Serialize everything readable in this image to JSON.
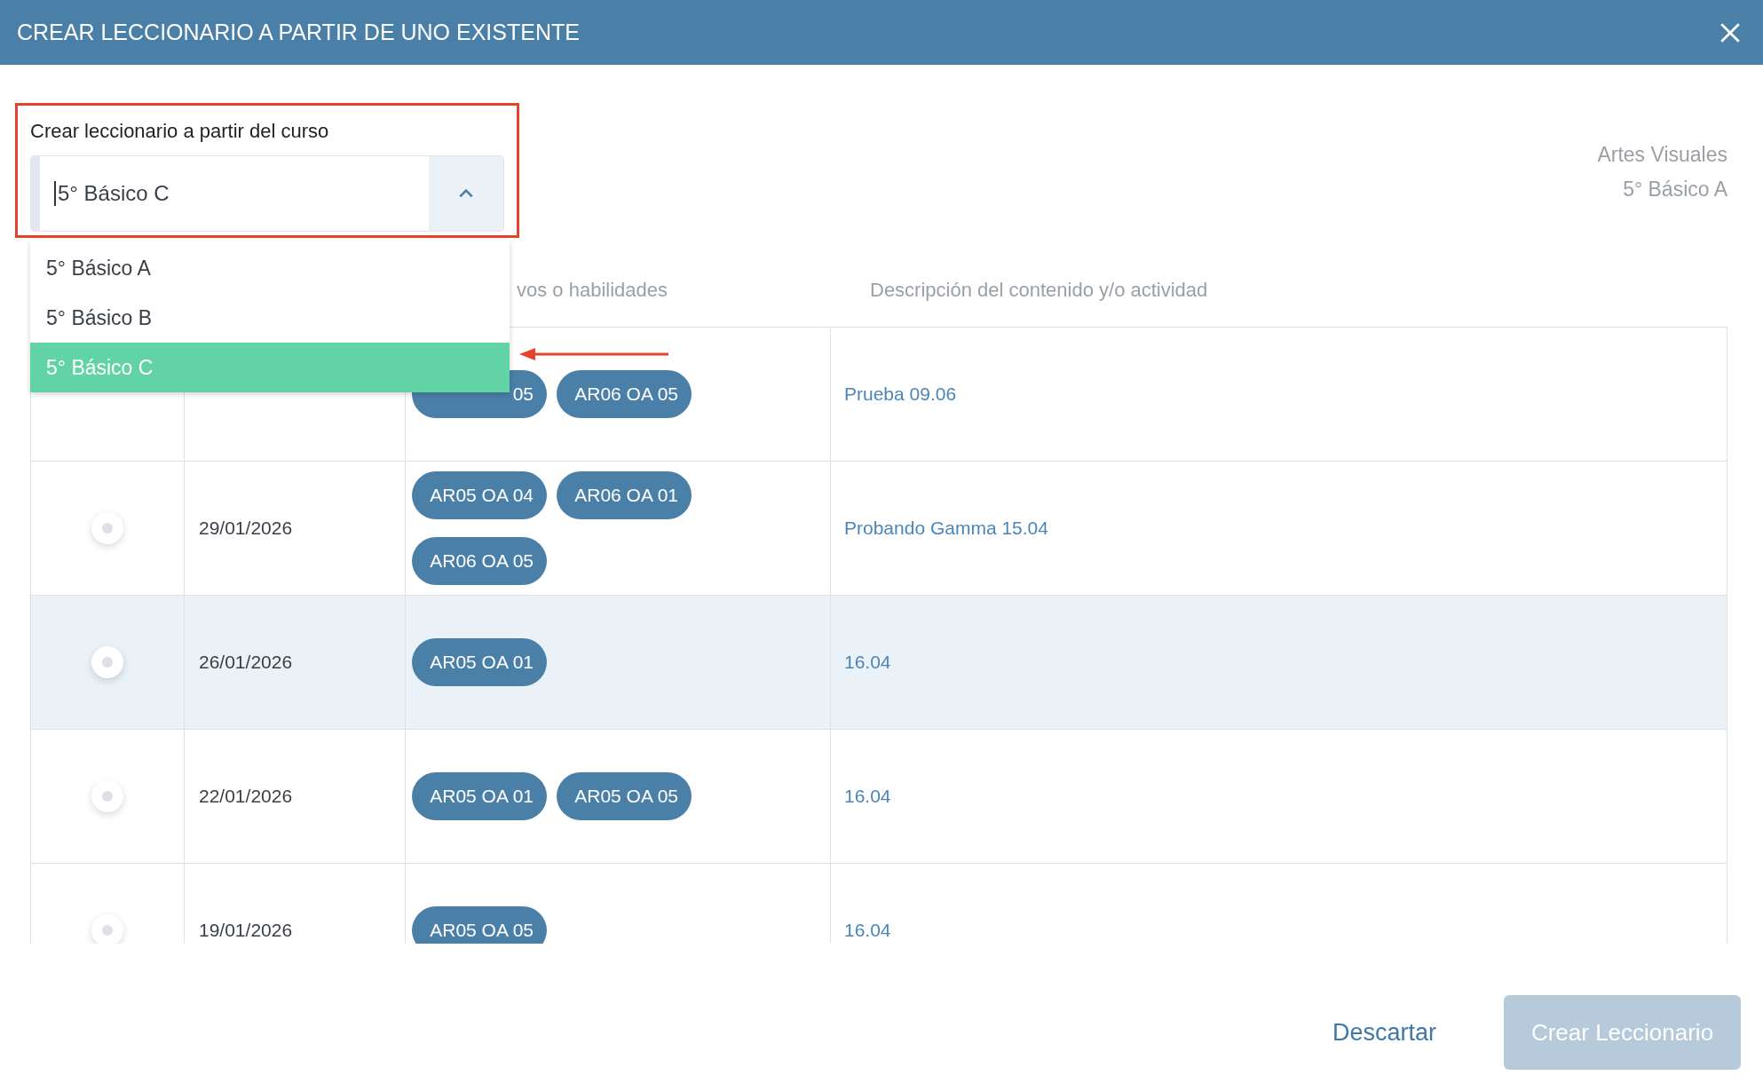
{
  "window": {
    "title": "CREAR LECCIONARIO A PARTIR DE UNO EXISTENTE"
  },
  "course_select": {
    "label": "Crear leccionario a partir del curso",
    "value": "5° Básico C",
    "expanded": true,
    "options": [
      {
        "label": "5° Básico A",
        "selected": false
      },
      {
        "label": "5° Básico B",
        "selected": false
      },
      {
        "label": "5° Básico C",
        "selected": true
      }
    ]
  },
  "context": {
    "subject": "Artes Visuales",
    "course": "5° Básico A"
  },
  "table": {
    "columns": [
      "vos o habilidades",
      "Descripción del contenido y/o actividad"
    ],
    "rows": [
      {
        "highlighted": false,
        "date": "",
        "chips": [
          "05",
          "AR06 OA 05"
        ],
        "description": "Prueba 09.06"
      },
      {
        "selected": false,
        "highlighted": false,
        "date": "29/01/2026",
        "chips": [
          "AR05 OA 04",
          "AR06 OA 01",
          "AR06 OA 05"
        ],
        "description": "Probando Gamma 15.04"
      },
      {
        "selected": false,
        "highlighted": true,
        "date": "26/01/2026",
        "chips": [
          "AR05 OA 01"
        ],
        "description": "16.04"
      },
      {
        "selected": false,
        "highlighted": false,
        "date": "22/01/2026",
        "chips": [
          "AR05 OA 01",
          "AR05 OA 05"
        ],
        "description": "16.04"
      },
      {
        "selected": false,
        "highlighted": false,
        "date": "19/01/2026",
        "chips": [
          "AR05 OA 05"
        ],
        "description": "16.04"
      }
    ]
  },
  "buttons": [
    {
      "kind": "link",
      "label": "Descartar",
      "disabled": false
    },
    {
      "kind": "primary",
      "label": "Crear Leccionario",
      "disabled": true
    }
  ]
}
